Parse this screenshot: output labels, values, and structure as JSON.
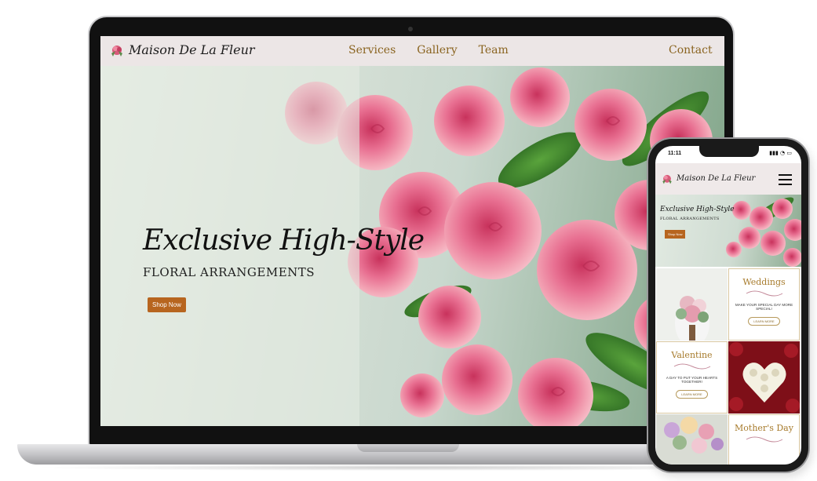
{
  "desktop": {
    "brand": {
      "name": "Maison De La Fleur"
    },
    "nav": {
      "links": [
        "Services",
        "Gallery",
        "Team"
      ],
      "contact": "Contact"
    },
    "hero": {
      "headline": "Exclusive High-Style",
      "subheadline": "FLORAL ARRANGEMENTS",
      "button": "Shop Now"
    }
  },
  "mobile": {
    "status": {
      "time": "11:11",
      "icons": "▮▮▮ ◔ ▭"
    },
    "brand": {
      "name": "Maison De La Fleur"
    },
    "hero": {
      "headline": "Exclusive High-Style",
      "subheadline": "FLORAL ARRANGEMENTS",
      "button": "Shop Now"
    },
    "services": [
      {
        "title": "Weddings",
        "desc": "MAKE YOUR SPECIAL DAY MORE SPECIAL!",
        "button": "LEARN MORE"
      },
      {
        "title": "Valentine",
        "desc": "A DAY TO PUT YOUR HEARTS TOGETHER!",
        "button": "LEARN MORE"
      },
      {
        "title": "Mother's Day"
      }
    ]
  },
  "colors": {
    "accent": "#b7651f",
    "nav_link": "#8a6420",
    "gold": "#a77b2c",
    "nav_bg": "#ece6e6"
  },
  "icons": {
    "brand_logo": "rose-logo-icon",
    "menu": "hamburger-menu-icon"
  }
}
